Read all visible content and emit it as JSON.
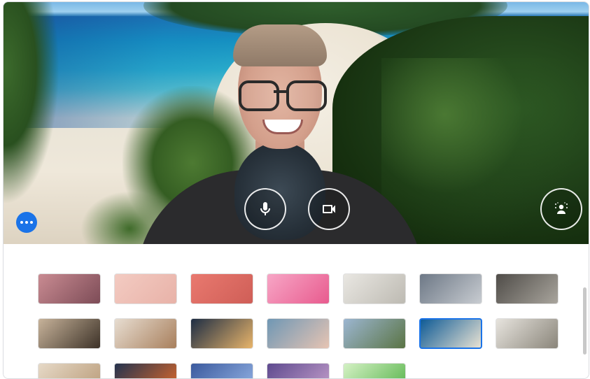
{
  "preview": {
    "controls": [
      {
        "name": "microphone-button",
        "icon": "microphone-icon"
      },
      {
        "name": "camera-button",
        "icon": "video-camera-icon"
      },
      {
        "name": "background-effects-button",
        "icon": "person-blur-icon"
      }
    ],
    "more_options_icon": "more-horizontal-icon"
  },
  "gallery": {
    "selected_index": 19,
    "tiles": [
      {
        "label": "purple-gradient",
        "colors": [
          "#8f7aa0",
          "#b69aa8"
        ]
      },
      {
        "label": "soft-light",
        "colors": [
          "#efe6df",
          "#e6dbd1"
        ]
      },
      {
        "label": "violet-glow",
        "colors": [
          "#b28fd8",
          "#d7a3d4"
        ]
      },
      {
        "label": "deep-ocean",
        "colors": [
          "#185d8a",
          "#2a8ab1"
        ]
      },
      {
        "label": "red-flowers",
        "colors": [
          "#a22a3a",
          "#5e1a25"
        ]
      },
      {
        "label": "city-night",
        "colors": [
          "#1b2b4e",
          "#5a3b7a"
        ]
      },
      {
        "label": "pink-blossoms",
        "colors": [
          "#d9524f",
          "#f29a92"
        ]
      },
      {
        "label": "floral-pattern",
        "colors": [
          "#c98b92",
          "#7d4c57"
        ]
      },
      {
        "label": "pink-dots",
        "colors": [
          "#f3cbc2",
          "#e8b2a8"
        ]
      },
      {
        "label": "red-grid",
        "colors": [
          "#e9796f",
          "#cf5e57"
        ]
      },
      {
        "label": "pink-petals",
        "colors": [
          "#f7a6c6",
          "#e85b8e"
        ]
      },
      {
        "label": "white-office",
        "colors": [
          "#e9e7e2",
          "#bdbab2"
        ]
      },
      {
        "label": "glass-atrium",
        "colors": [
          "#6d7886",
          "#c8ccd1"
        ]
      },
      {
        "label": "grey-room",
        "colors": [
          "#4f4c48",
          "#a9a59d"
        ]
      },
      {
        "label": "bookshelf",
        "colors": [
          "#c7b39a",
          "#3d3228"
        ]
      },
      {
        "label": "living-room",
        "colors": [
          "#e7ddd1",
          "#a87f5c"
        ]
      },
      {
        "label": "night-cafe",
        "colors": [
          "#1d2d44",
          "#e8b46a"
        ]
      },
      {
        "label": "sea-balcony",
        "colors": [
          "#6f97b4",
          "#e6c4b3"
        ]
      },
      {
        "label": "mountain-lake",
        "colors": [
          "#9cb6d1",
          "#5a7444"
        ]
      },
      {
        "label": "tropical-beach",
        "colors": [
          "#0f5b96",
          "#e8e2d3"
        ]
      },
      {
        "label": "horses",
        "colors": [
          "#e7e4de",
          "#8a857a"
        ]
      },
      {
        "label": "wood-interior",
        "colors": [
          "#e6d9c7",
          "#b99b78"
        ]
      },
      {
        "label": "autumn-leaves",
        "colors": [
          "#24334f",
          "#e06a2a"
        ]
      },
      {
        "label": "blue-ferns",
        "colors": [
          "#3b5a9e",
          "#93b2e4"
        ]
      },
      {
        "label": "purple-skyline",
        "colors": [
          "#5e4a8f",
          "#c49fcb"
        ]
      },
      {
        "label": "green-bubbles",
        "colors": [
          "#d4f1c4",
          "#56b34a"
        ]
      }
    ]
  }
}
